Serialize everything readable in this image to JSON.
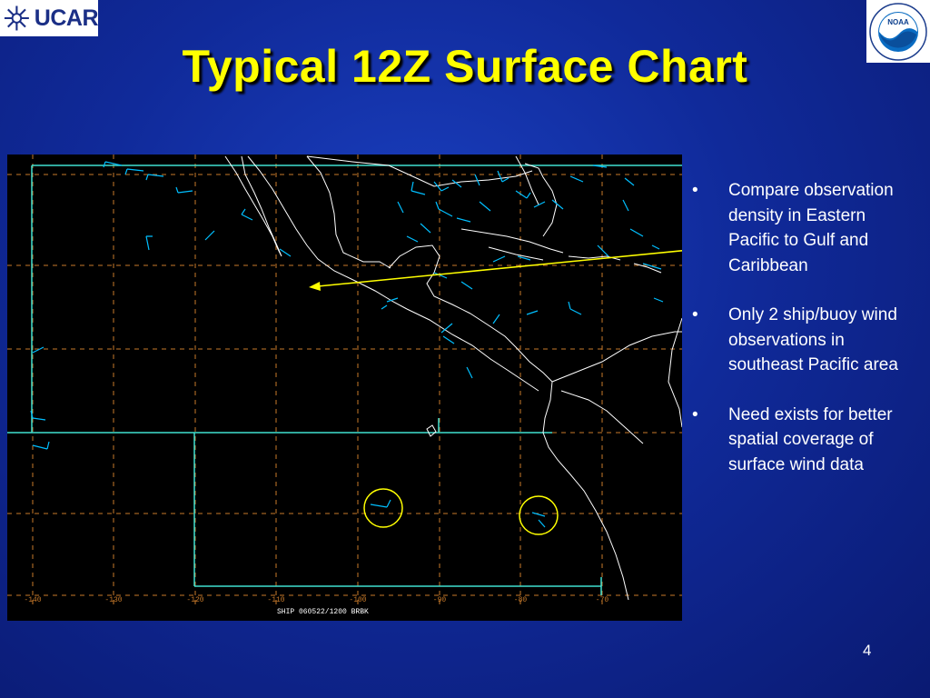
{
  "header": {
    "ucar_logo_text": "UCAR",
    "noaa_logo_text": "NOAA",
    "title": "Typical 12Z Surface Chart"
  },
  "map": {
    "footer_label": "SHIP 060522/1200 BRBK",
    "longitude_labels": [
      "-140",
      "-130",
      "-120",
      "-110",
      "-100",
      "-90",
      "-80",
      "-70"
    ],
    "background_color": "#000000",
    "coastline_color": "#ffffff",
    "wind_barb_color": "#00bfff",
    "grid_color": "#c87a2a",
    "boundary_color": "#40e0d0",
    "highlight_color": "#ffff00"
  },
  "bullets": [
    {
      "symbol": "•",
      "text": "Compare observation density in Eastern Pacific to Gulf and Caribbean"
    },
    {
      "symbol": "•",
      "text": "Only 2 ship/buoy wind observations in southeast Pacific area"
    },
    {
      "symbol": "•",
      "text": "Need exists for better spatial coverage of surface wind data"
    }
  ],
  "page_number": "4"
}
